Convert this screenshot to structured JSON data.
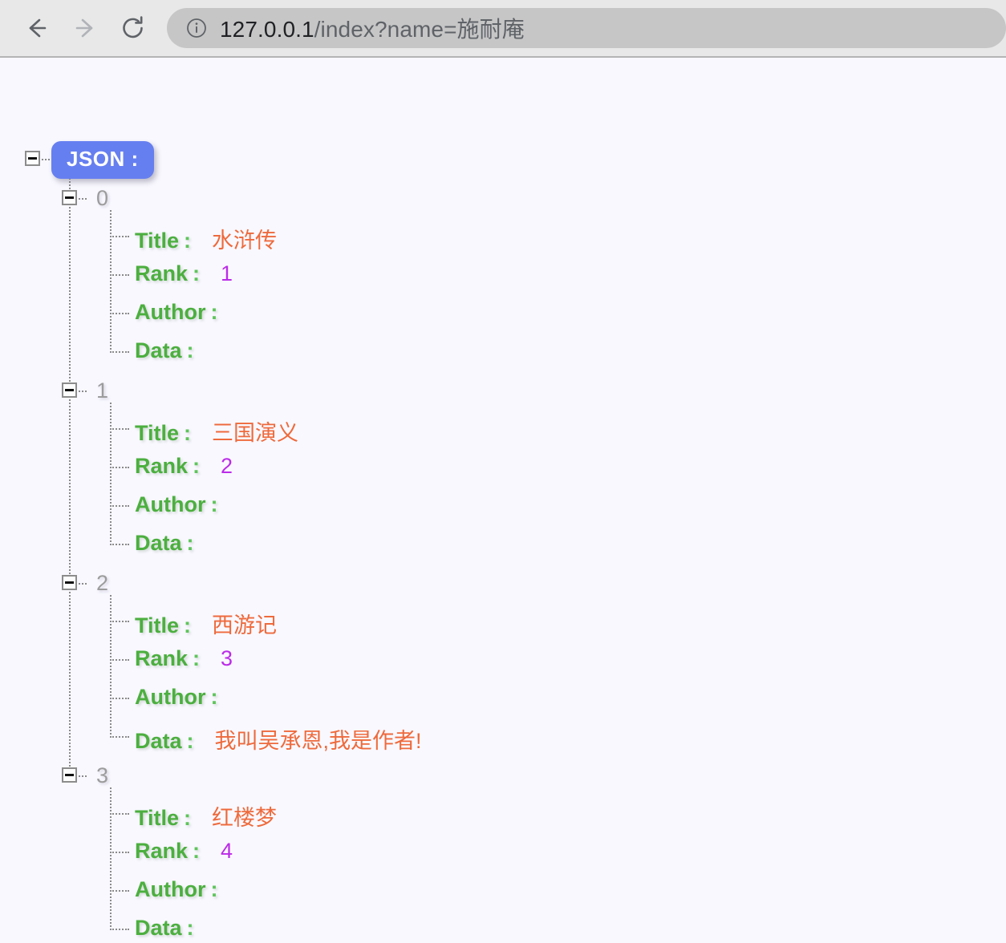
{
  "browser": {
    "back_icon": "back-arrow-icon",
    "forward_icon": "forward-arrow-icon",
    "reload_icon": "reload-icon",
    "info_icon": "info-circle-icon",
    "url_host": "127.0.0.1",
    "url_path": "/index?name=施耐庵",
    "url_full": "127.0.0.1/index?name=施耐庵"
  },
  "viewer": {
    "root_label": "JSON :",
    "toggle_icon": "minus-square-toggle-icon",
    "colon": ":",
    "colors": {
      "root_badge": "#667ff0",
      "key": "#4caf3f",
      "string_value": "#ee6a3c",
      "number_value": "#bb2ce8",
      "index": "#9c9c9c",
      "background": "#f9f8ff"
    },
    "keys": {
      "title": "Title",
      "rank": "Rank",
      "author": "Author",
      "data": "Data"
    },
    "items": [
      {
        "index": "0",
        "title": "水浒传",
        "rank": "1",
        "author": "",
        "data": ""
      },
      {
        "index": "1",
        "title": "三国演义",
        "rank": "2",
        "author": "",
        "data": ""
      },
      {
        "index": "2",
        "title": "西游记",
        "rank": "3",
        "author": "",
        "data": "我叫吴承恩,我是作者!"
      },
      {
        "index": "3",
        "title": "红楼梦",
        "rank": "4",
        "author": "",
        "data": ""
      }
    ]
  }
}
